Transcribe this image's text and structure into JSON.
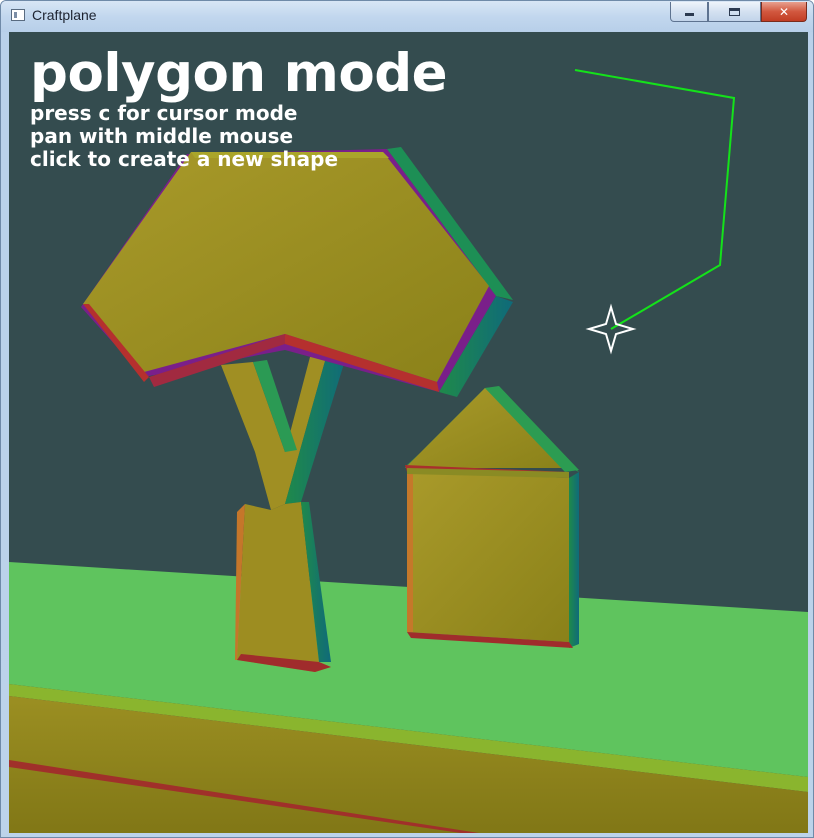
{
  "window": {
    "title": "Craftplane",
    "close_glyph": "✕"
  },
  "overlay": {
    "heading": "polygon mode",
    "hints": [
      "press c for cursor mode",
      "pan with middle mouse",
      "click to create a new shape"
    ]
  },
  "scene": {
    "background_color": "#344c4f",
    "ground_color": "#5cc35c",
    "wood_color": "#8f8a1c",
    "polygon_line_color": "#14e21a",
    "cursor_color": "#ffffff",
    "cursor_icon": "four-point-star-cursor-icon"
  }
}
